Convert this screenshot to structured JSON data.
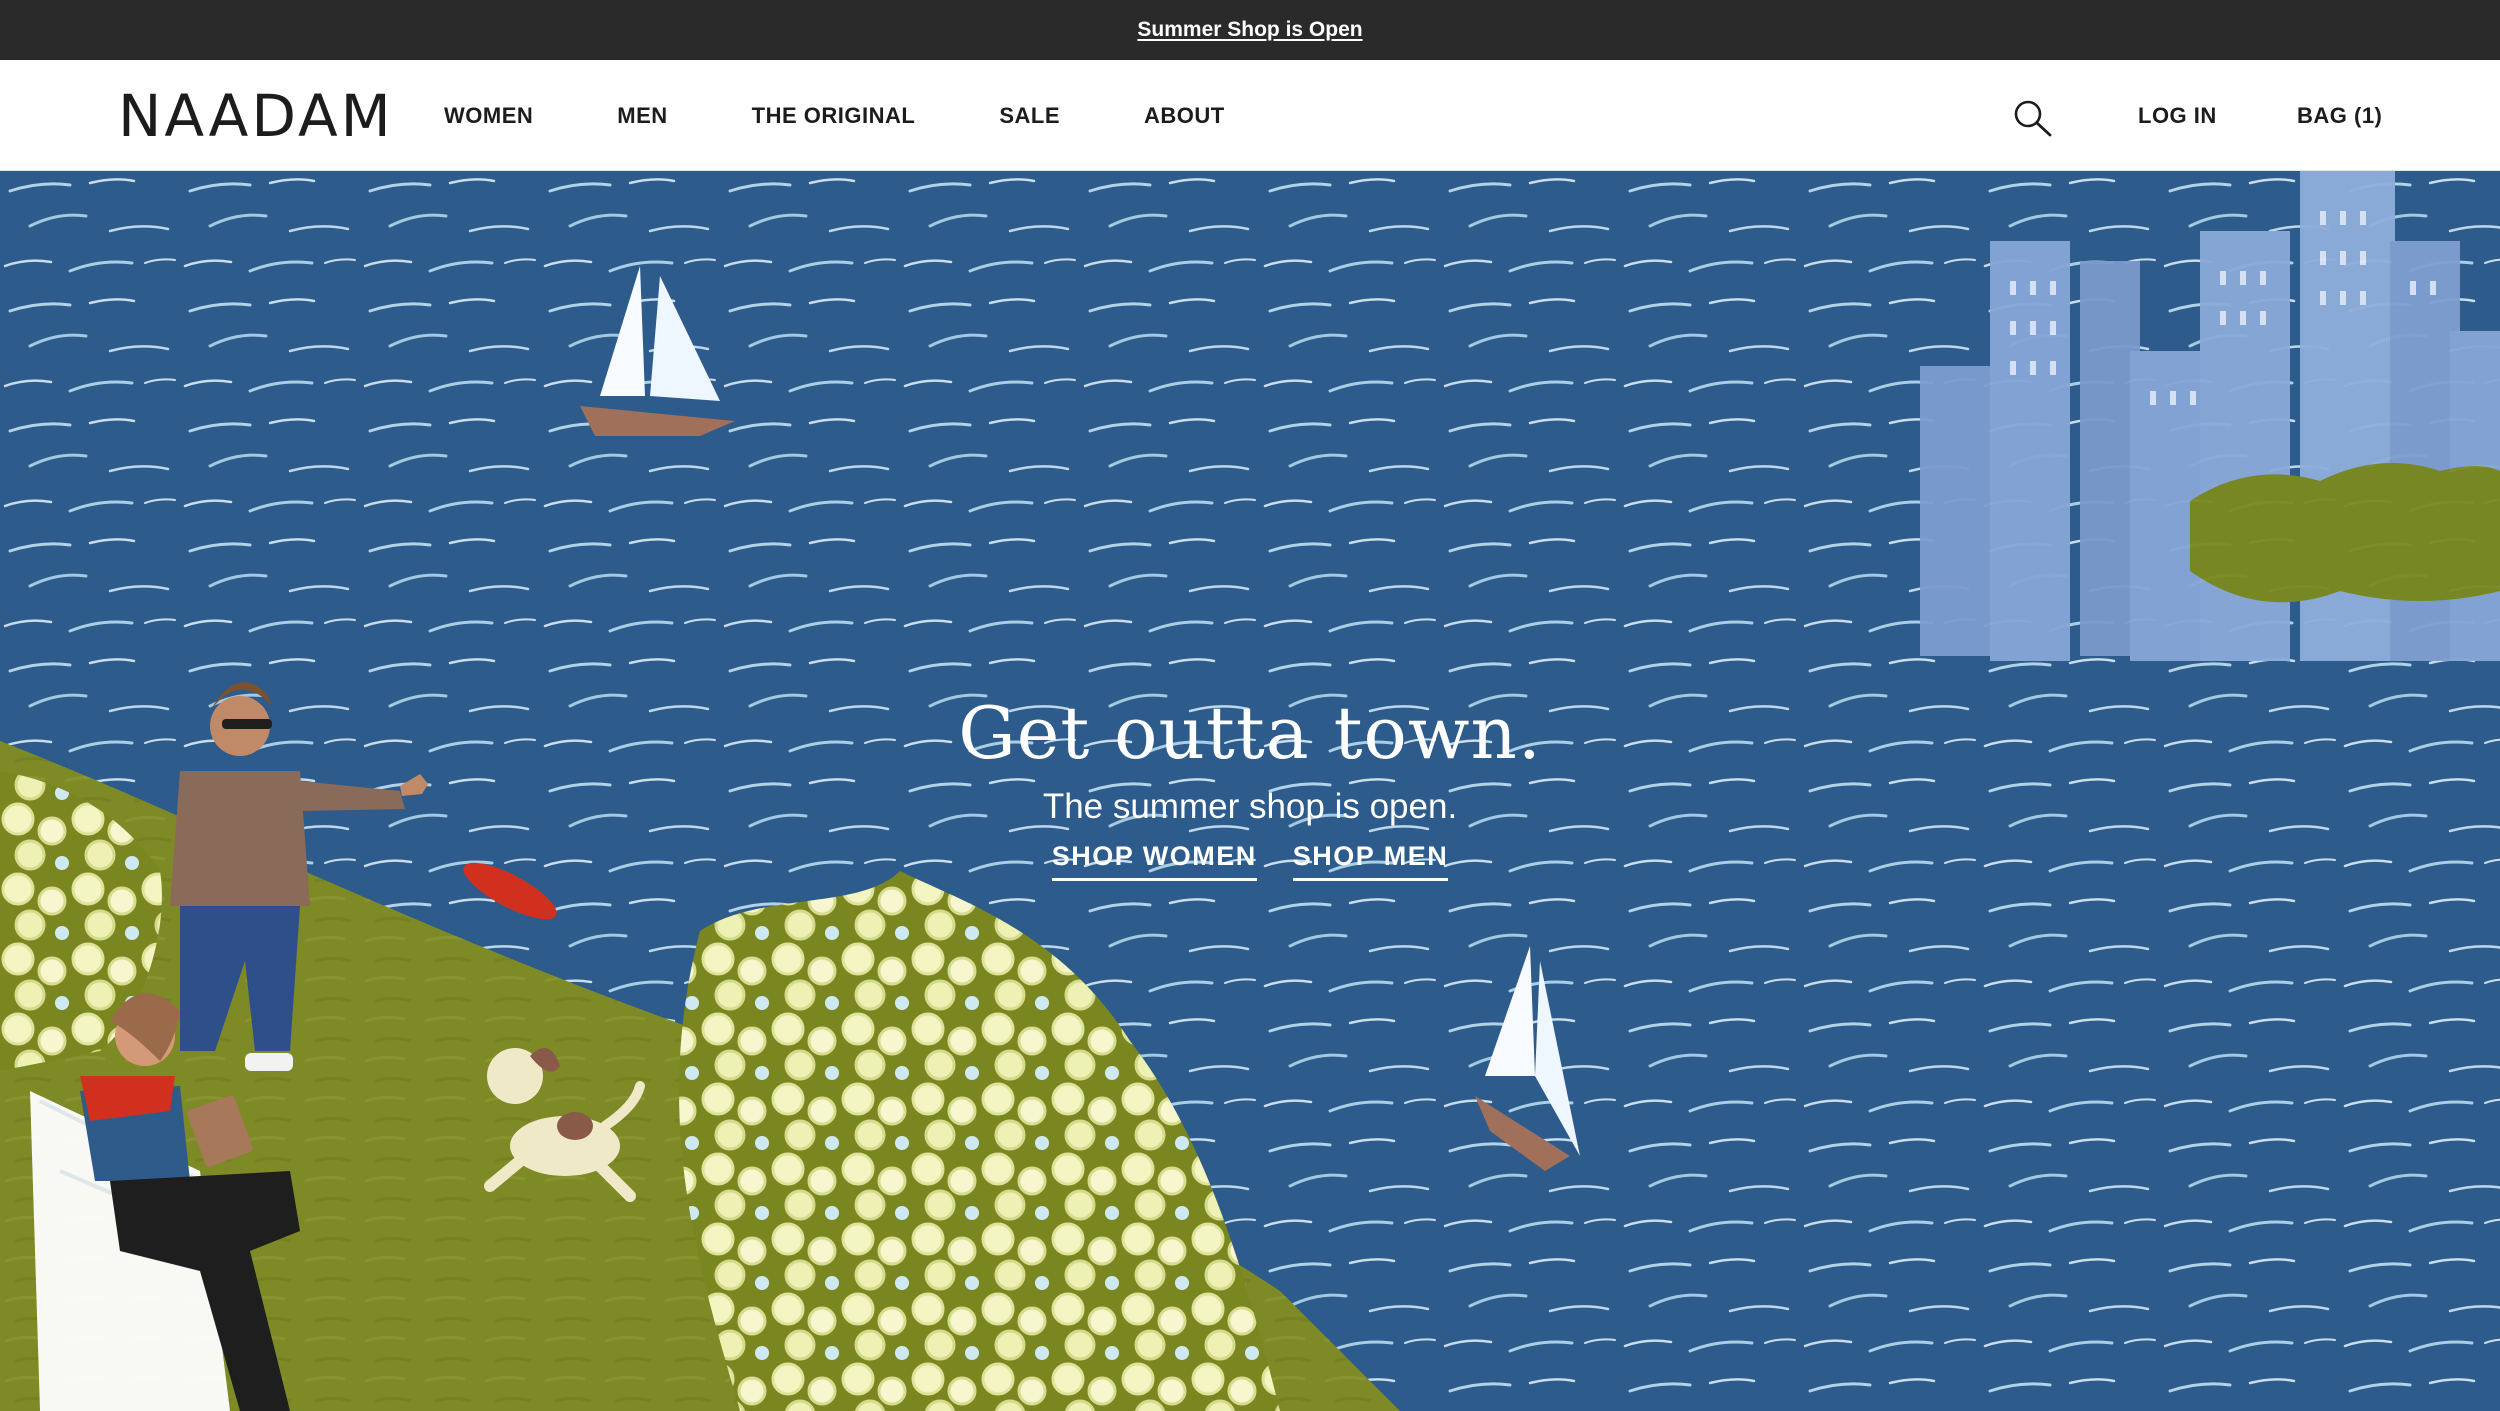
{
  "announcement": {
    "text": "Summer Shop is Open"
  },
  "header": {
    "logo": "NAADAM",
    "nav": [
      "WOMEN",
      "MEN",
      "THE ORIGINAL",
      "SALE",
      "ABOUT"
    ],
    "login": "LOG IN",
    "bag": "BAG (1)"
  },
  "hero": {
    "title": "Get outta town.",
    "subtitle": "The summer shop is open.",
    "cta_women": "SHOP WOMEN",
    "cta_men": "SHOP MEN"
  },
  "colors": {
    "announcement_bg": "#2a2a2a",
    "header_bg": "#ffffff",
    "water": "#2d5b8b",
    "grass": "#7d8a26",
    "flowers": "#f2f4b8",
    "text": "#1c1c1c"
  },
  "icons": {
    "search": "search-icon"
  }
}
